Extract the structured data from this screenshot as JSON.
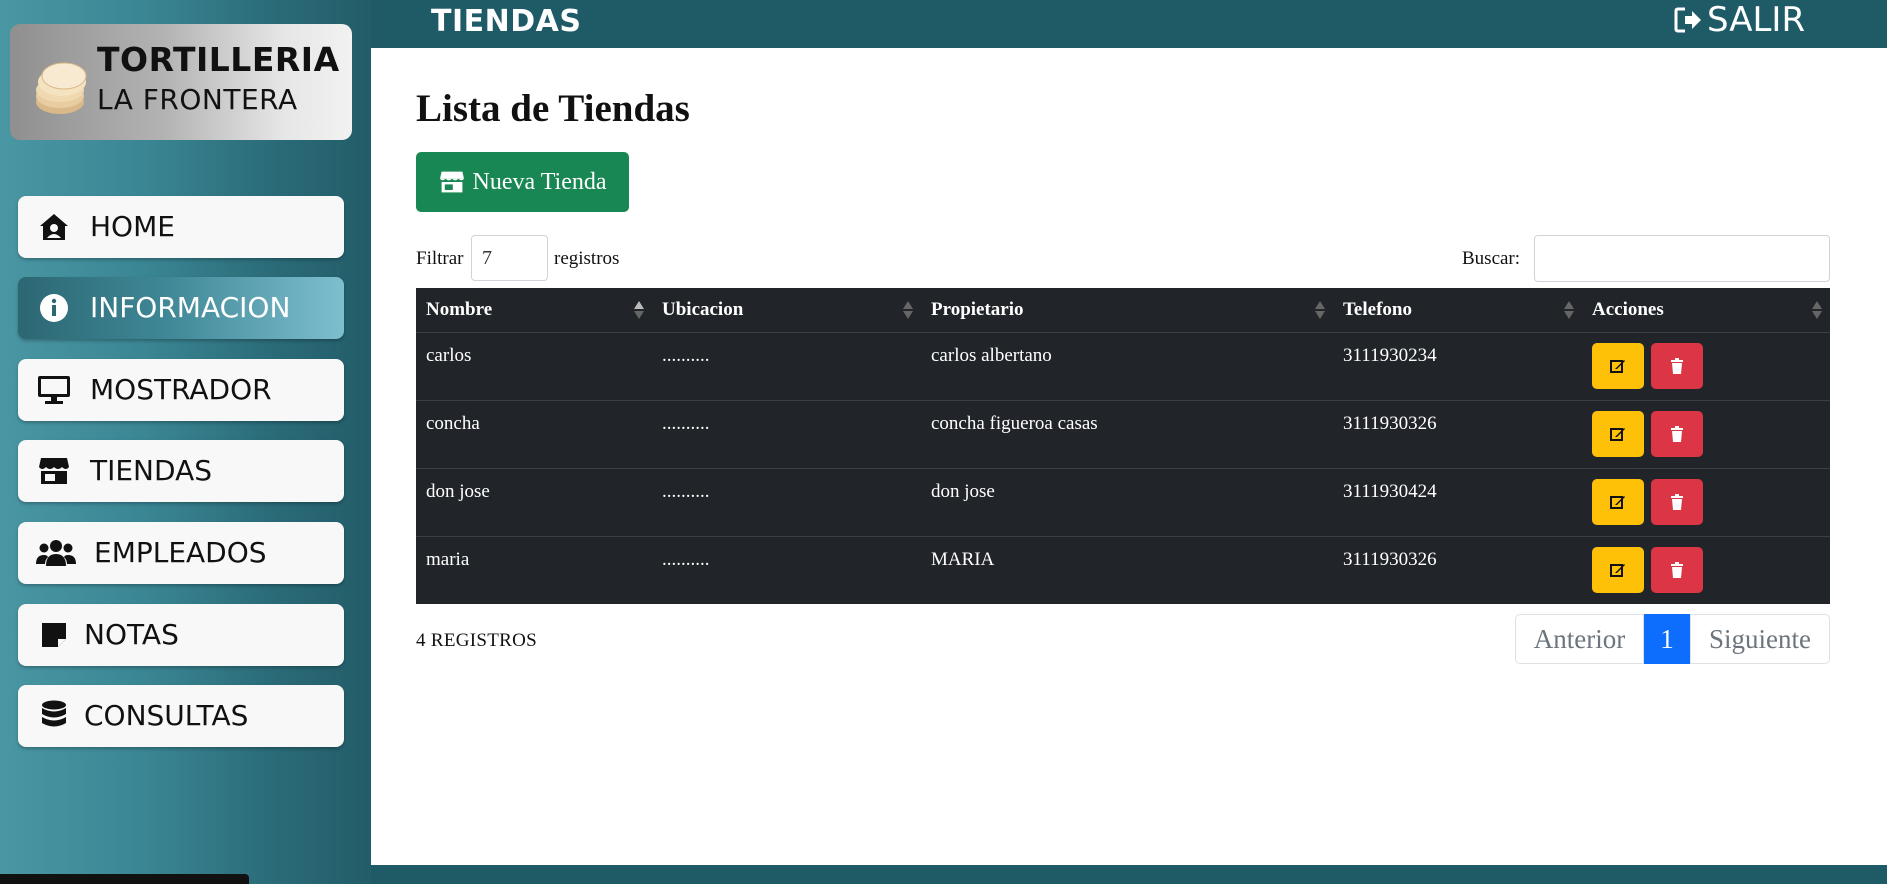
{
  "brand": {
    "line1": "TORTILLERIA",
    "line2": "LA FRONTERA"
  },
  "sidebar": {
    "items": [
      {
        "label": "HOME",
        "icon": "house-user-icon",
        "active": false
      },
      {
        "label": "INFORMACION",
        "icon": "info-circle-icon",
        "active": true
      },
      {
        "label": "MOSTRADOR",
        "icon": "desktop-icon",
        "active": false
      },
      {
        "label": "TIENDAS",
        "icon": "store-icon",
        "active": false
      },
      {
        "label": "EMPLEADOS",
        "icon": "users-icon",
        "active": false
      },
      {
        "label": "NOTAS",
        "icon": "sticky-note-icon",
        "active": false
      },
      {
        "label": "CONSULTAS",
        "icon": "database-icon",
        "active": false
      }
    ]
  },
  "topbar": {
    "title": "TIENDAS",
    "logout_label": "SALIR"
  },
  "main": {
    "page_title": "Lista de Tiendas",
    "new_button": "Nueva Tienda",
    "filter_prefix": "Filtrar",
    "filter_value": "7",
    "filter_suffix": "registros",
    "search_label": "Buscar:",
    "search_value": "",
    "table": {
      "headers": [
        "Nombre",
        "Ubicacion",
        "Propietario",
        "Telefono",
        "Acciones"
      ],
      "rows": [
        {
          "nombre": "carlos",
          "ubicacion": "..........",
          "propietario": "carlos albertano",
          "telefono": "3111930234"
        },
        {
          "nombre": "concha",
          "ubicacion": "..........",
          "propietario": "concha figueroa casas",
          "telefono": "3111930326"
        },
        {
          "nombre": "don jose",
          "ubicacion": "..........",
          "propietario": "don jose",
          "telefono": "3111930424"
        },
        {
          "nombre": "maria",
          "ubicacion": "..........",
          "propietario": "MARIA",
          "telefono": "3111930326"
        }
      ]
    },
    "records_label": "4 REGISTROS",
    "pagination": {
      "prev": "Anterior",
      "current": "1",
      "next": "Siguiente"
    }
  },
  "colors": {
    "topbar": "#1f5a67",
    "primary_button": "#198754",
    "table_bg": "#212529",
    "edit_button": "#ffc107",
    "delete_button": "#dc3545",
    "page_active": "#0d6efd"
  }
}
